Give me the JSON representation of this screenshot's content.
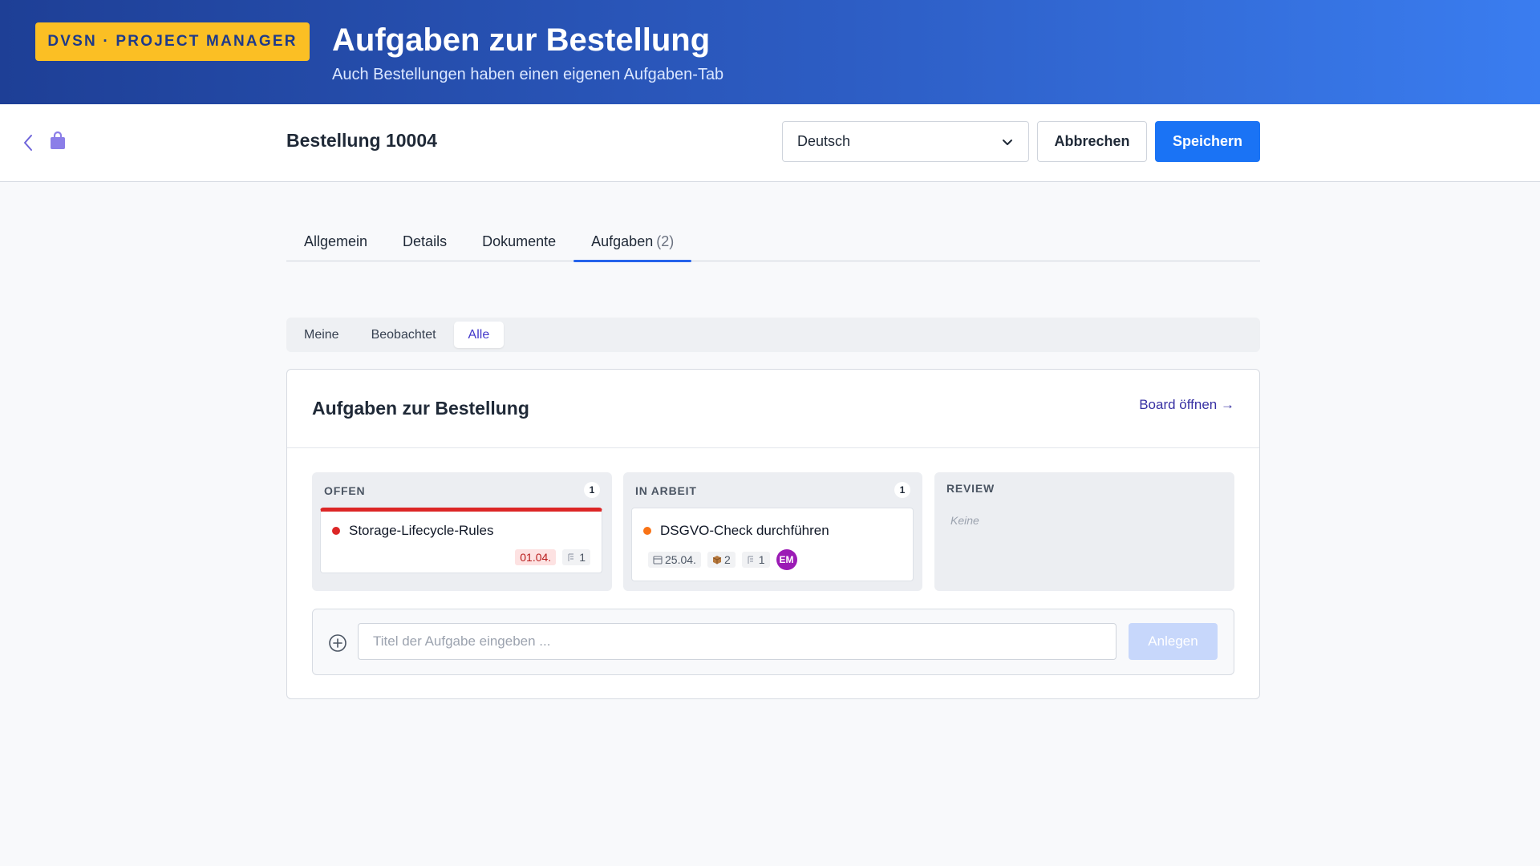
{
  "banner": {
    "brand": "DVSN · PROJECT MANAGER",
    "title": "Aufgaben zur Bestellung",
    "subtitle": "Auch Bestellungen haben einen eigenen Aufgaben-Tab"
  },
  "header": {
    "record_title": "Bestellung 10004",
    "language": "Deutsch",
    "cancel_label": "Abbrechen",
    "save_label": "Speichern"
  },
  "tabs": [
    {
      "label": "Allgemein"
    },
    {
      "label": "Details"
    },
    {
      "label": "Dokumente"
    },
    {
      "label": "Aufgaben",
      "count": "(2)",
      "active": true
    }
  ],
  "filters": [
    {
      "label": "Meine"
    },
    {
      "label": "Beobachtet"
    },
    {
      "label": "Alle",
      "active": true
    }
  ],
  "card": {
    "title": "Aufgaben zur Bestellung",
    "board_link": "Board öffnen →"
  },
  "columns": [
    {
      "name": "OFFEN",
      "count": "1",
      "tasks": [
        {
          "title": "Storage-Lifecycle-Rules",
          "due": "01.04.",
          "subtasks": "1",
          "priority_color": "#dc2626"
        }
      ]
    },
    {
      "name": "IN ARBEIT",
      "count": "1",
      "tasks": [
        {
          "title": "DSGVO-Check durchführen",
          "due": "25.04.",
          "items": "2",
          "subtasks": "1",
          "assignee": "EM",
          "priority_color": "#f97316"
        }
      ]
    },
    {
      "name": "REVIEW",
      "empty": "Keine"
    }
  ],
  "new_task": {
    "placeholder": "Titel der Aufgabe eingeben ...",
    "create_label": "Anlegen"
  },
  "colors": {
    "accent": "#1a73f5",
    "brand_badge": "#fbbf24",
    "link": "#3730a3",
    "avatar": "#9b1bb5"
  }
}
